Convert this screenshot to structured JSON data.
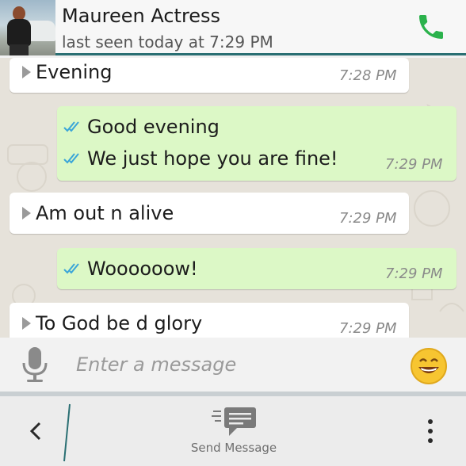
{
  "header": {
    "contact_name": "Maureen Actress",
    "last_seen": "last seen today at 7:29 PM",
    "call_icon": "phone-icon",
    "accent_color": "#2a6f73",
    "call_color": "#2bb24c"
  },
  "messages": [
    {
      "direction": "incoming",
      "lines": [
        "Evening"
      ],
      "time": "7:28 PM"
    },
    {
      "direction": "outgoing",
      "lines": [
        "Good evening",
        "We just hope you are fine!"
      ],
      "time": "7:29 PM",
      "status": "read"
    },
    {
      "direction": "incoming",
      "lines": [
        "Am out n alive"
      ],
      "time": "7:29 PM"
    },
    {
      "direction": "outgoing",
      "lines": [
        "Woooooow!"
      ],
      "time": "7:29 PM",
      "status": "read"
    },
    {
      "direction": "incoming",
      "lines": [
        "To God be d glory"
      ],
      "time": "7:29 PM"
    }
  ],
  "input": {
    "placeholder": "Enter a message",
    "mic_icon": "microphone-icon",
    "emoji_icon": "smiley-icon"
  },
  "action_bar": {
    "back_icon": "chevron-left-icon",
    "send_label": "Send Message",
    "send_icon": "send-message-icon",
    "overflow_icon": "more-vertical-icon"
  },
  "colors": {
    "incoming_bubble": "#ffffff",
    "outgoing_bubble": "#dcf8c6",
    "read_tick": "#3aa5d8",
    "chat_background": "#e6e2da"
  }
}
